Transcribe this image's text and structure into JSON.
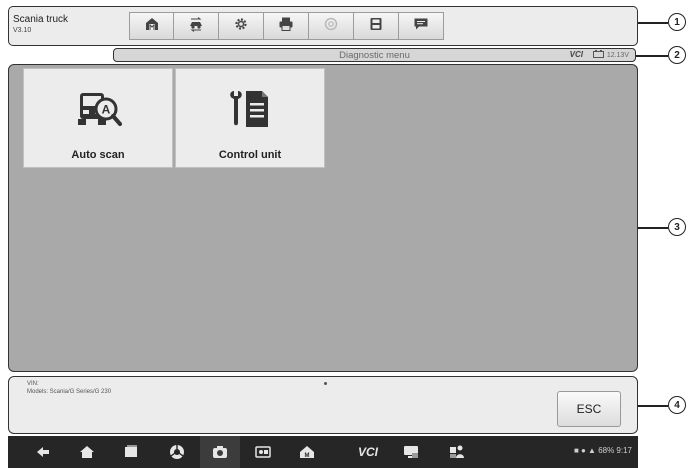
{
  "header": {
    "title": "Scania truck",
    "version": "V3.10",
    "toolbar": [
      {
        "name": "home-icon"
      },
      {
        "name": "vehicle-swap-icon"
      },
      {
        "name": "settings-icon"
      },
      {
        "name": "print-icon"
      },
      {
        "name": "help-icon"
      },
      {
        "name": "save-icon"
      },
      {
        "name": "data-logging-icon"
      }
    ]
  },
  "menubar": {
    "title": "Diagnostic menu",
    "vci_label": "VCI",
    "battery_voltage": "12.13V"
  },
  "main": {
    "tiles": [
      {
        "label": "Auto scan",
        "icon": "auto-scan-icon"
      },
      {
        "label": "Control unit",
        "icon": "control-unit-icon"
      }
    ]
  },
  "footer": {
    "vin_label": "VIN:",
    "models": "Models: Scania/G Series/G 230",
    "esc_label": "ESC"
  },
  "callouts": [
    "1",
    "2",
    "3",
    "4"
  ],
  "navbar": {
    "vci_label": "VCI",
    "status_text": "68% 9:17"
  },
  "colors": {
    "main_background": "#a9a9a9",
    "panel_background": "#ececec",
    "navbar_background": "#262626",
    "outline": "#333333"
  }
}
